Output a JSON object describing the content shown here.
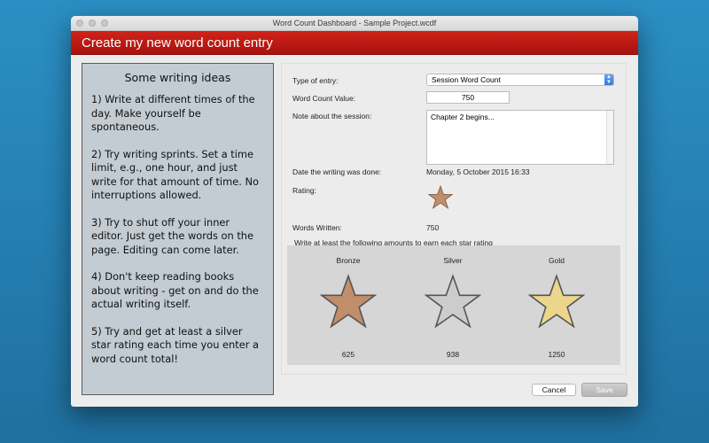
{
  "window": {
    "title": "Word Count Dashboard - Sample Project.wcdf",
    "header": "Create my new word count entry"
  },
  "ideas": {
    "heading": "Some writing ideas",
    "items": [
      "1) Write at different times of the day. Make yourself be spontaneous.",
      "2) Try writing sprints. Set a time limit, e.g., one hour, and just write for that amount of time. No interruptions allowed.",
      "3) Try to shut off your inner editor. Just get the words on the page. Editing can come later.",
      "4) Don't keep reading books about writing - get on and do the actual writing itself.",
      "5) Try and get at least a silver star rating each time you enter a word count total!"
    ]
  },
  "form": {
    "type_label": "Type of entry:",
    "type_value": "Session Word Count",
    "count_label": "Word Count Value:",
    "count_value": "750",
    "note_label": "Note about the session:",
    "note_value": "Chapter 2 begins...",
    "date_label": "Date the writing was done:",
    "date_value": "Monday, 5 October 2015 16:33",
    "rating_label": "Rating:",
    "words_label": "Words Written:",
    "words_value": "750",
    "targets_label": "Write at least the following amounts to earn each star rating"
  },
  "stars": [
    {
      "name": "Bronze",
      "value": "625",
      "color": "#c08e6a"
    },
    {
      "name": "Silver",
      "value": "938",
      "color": "#cccccc"
    },
    {
      "name": "Gold",
      "value": "1250",
      "color": "#ecd68c"
    }
  ],
  "current_rating_color": "#c08e6a",
  "buttons": {
    "cancel": "Cancel",
    "save": "Save"
  }
}
